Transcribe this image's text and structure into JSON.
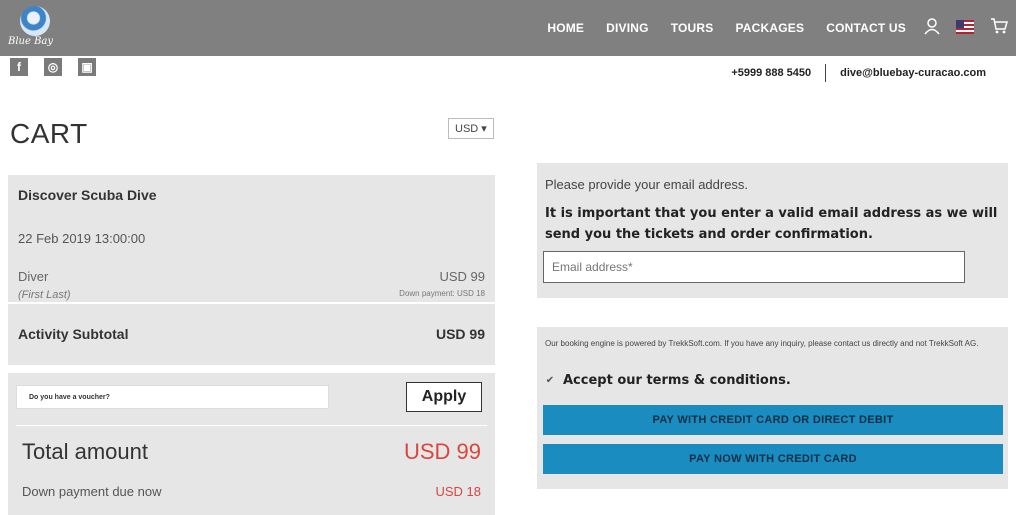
{
  "header": {
    "logo_text": "Blue Bay",
    "nav": [
      "HOME",
      "DIVING",
      "TOURS",
      "PACKAGES",
      "CONTACT US"
    ],
    "icons": [
      "user-icon",
      "flag-icon",
      "cart-icon"
    ]
  },
  "social": {
    "items": [
      {
        "name": "facebook-icon",
        "glyph": "f"
      },
      {
        "name": "tripadvisor-icon",
        "glyph": "◎"
      },
      {
        "name": "instagram-icon",
        "glyph": "▣"
      }
    ]
  },
  "contact": {
    "phone": "+5999 888 5450",
    "email": "dive@bluebay-curacao.com"
  },
  "cart": {
    "title": "CART",
    "currency": "USD ▾",
    "activity": {
      "title": "Discover Scuba Dive",
      "date": "22 Feb 2019 13:00:00",
      "participant_type": "Diver",
      "participant_name": "(First Last)",
      "price": "USD 99",
      "down_payment": "Down payment: USD 18",
      "subtotal_label": "Activity Subtotal",
      "subtotal_value": "USD 99"
    },
    "voucher": {
      "placeholder": "Do you have a voucher?",
      "apply_label": "Apply"
    },
    "total_label": "Total amount",
    "total_value": "USD 99",
    "down_label": "Down payment due now",
    "down_value": "USD 18"
  },
  "checkout": {
    "prompt": "Please provide your email address.",
    "important": "It is important that you enter a valid email address as we will send you the tickets and order confirmation.",
    "email_placeholder": "Email address*",
    "note": "Our booking engine is powered by TrekkSoft.com. If you have any inquiry, please contact us directly and not TrekkSoft AG.",
    "terms_label": "Accept our terms & conditions.",
    "pay_button_1": "PAY WITH CREDIT CARD OR DIRECT DEBIT",
    "pay_button_2": "PAY NOW WITH CREDIT CARD"
  },
  "colors": {
    "nav_bg": "#808080",
    "card_bg": "#e6e6e6",
    "accent_red": "#d9463e",
    "pay_button": "#1a8cc0"
  }
}
